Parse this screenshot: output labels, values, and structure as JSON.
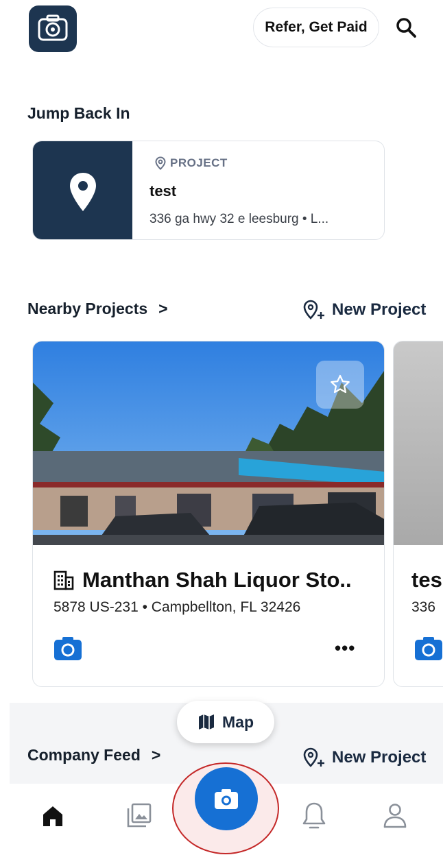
{
  "header": {
    "logo_icon": "camera-location-logo-icon",
    "refer_label": "Refer, Get Paid",
    "search_icon": "search-icon"
  },
  "jump_back_in": {
    "title": "Jump Back In",
    "card": {
      "type_label": "PROJECT",
      "name": "test",
      "address": "336 ga hwy 32 e leesburg • L..."
    }
  },
  "nearby": {
    "title": "Nearby Projects",
    "chevron": ">",
    "new_project_label": "New Project",
    "cards": [
      {
        "name": "Manthan Shah Liquor Sto..",
        "address": "5878 US-231 • Campbellton, FL 32426",
        "more_label": "•••"
      },
      {
        "name": "tes",
        "address": "336"
      }
    ]
  },
  "map_button": {
    "label": "Map"
  },
  "company_feed": {
    "title": "Company Feed",
    "chevron": ">",
    "new_project_label": "New Project"
  },
  "nav": {
    "items": [
      "home-icon",
      "gallery-icon",
      "camera-icon",
      "bell-icon",
      "user-icon"
    ]
  },
  "colors": {
    "brand_navy": "#1d3550",
    "accent_blue": "#1670d4",
    "highlight_red": "#c42828"
  }
}
